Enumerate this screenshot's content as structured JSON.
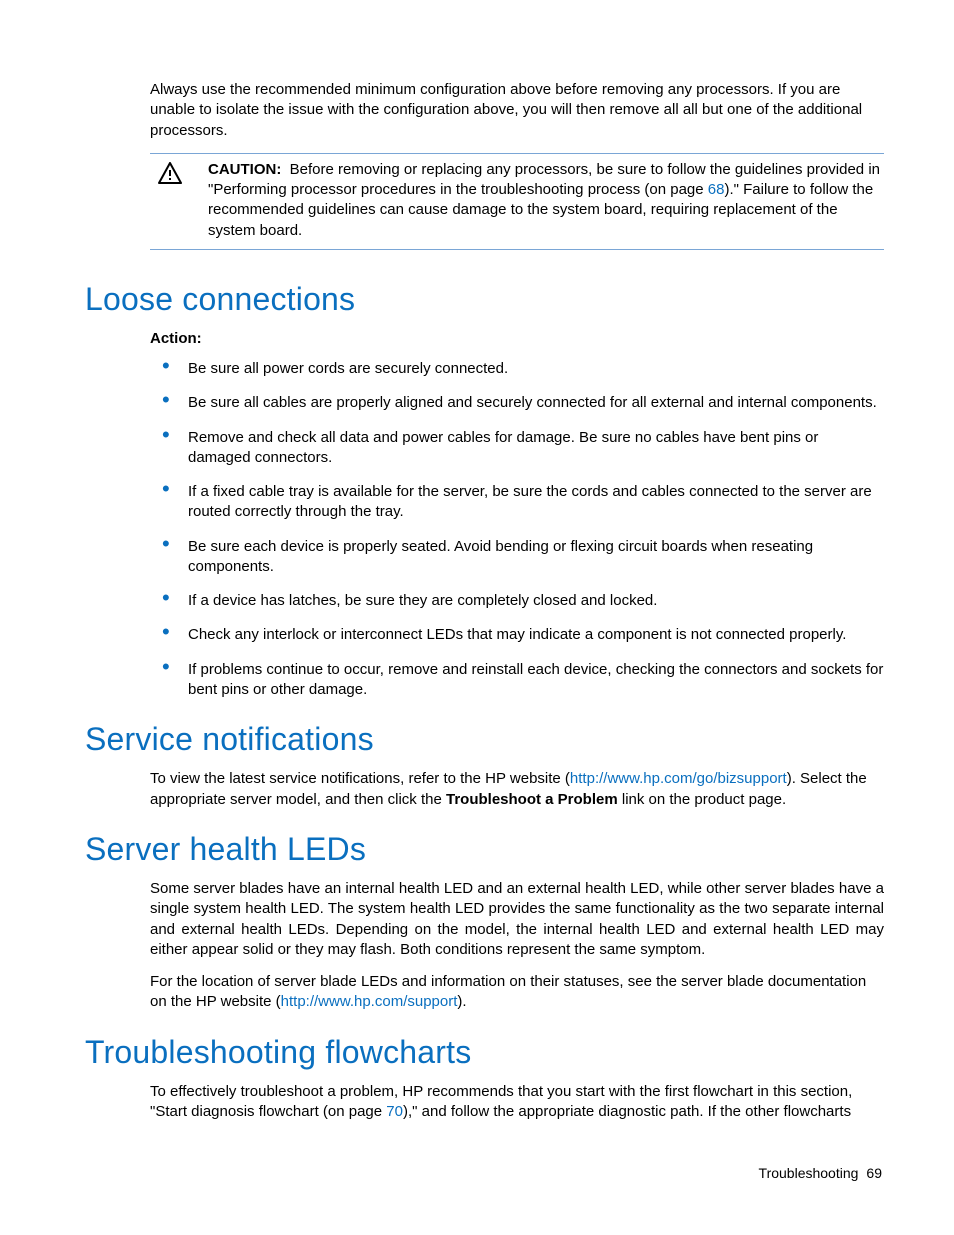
{
  "intro": "Always use the recommended minimum configuration above before removing any processors. If you are unable to isolate the issue with the configuration above, you will then remove all all but one of the additional processors.",
  "caution": {
    "label": "CAUTION:",
    "pre": "Before removing or replacing any processors, be sure to follow the guidelines provided in \"Performing processor procedures in the troubleshooting process (on page ",
    "pagelink": "68",
    "post": ").\" Failure to follow the recommended guidelines can cause damage to the system board, requiring replacement of the system board."
  },
  "section1": {
    "title": "Loose connections",
    "action_label": "Action",
    "items": [
      "Be sure all power cords are securely connected.",
      "Be sure all cables are properly aligned and securely connected for all external and internal components.",
      "Remove and check all data and power cables for damage. Be sure no cables have bent pins or damaged connectors.",
      "If a fixed cable tray is available for the server, be sure the cords and cables connected to the server are routed correctly through the tray.",
      "Be sure each device is properly seated. Avoid bending or flexing circuit boards when reseating components.",
      "If a device has latches, be sure they are completely closed and locked.",
      "Check any interlock or interconnect LEDs that may indicate a component is not connected properly.",
      "If problems continue to occur, remove and reinstall each device, checking the connectors and sockets for bent pins or other damage."
    ]
  },
  "section2": {
    "title": "Service notifications",
    "pre": "To view the latest service notifications, refer to the HP website (",
    "link": "http://www.hp.com/go/bizsupport",
    "mid": "). Select the appropriate server model, and then click the ",
    "bold": "Troubleshoot a Problem",
    "post": " link on the product page."
  },
  "section3": {
    "title": "Server health LEDs",
    "p1": "Some server blades have an internal health LED and an external health LED, while other server blades have a single system health LED. The system health LED provides the same functionality as the two separate internal and external health LEDs. Depending on the model, the internal health LED and external health LED may either appear solid or they may flash. Both conditions represent the same symptom.",
    "p2_pre": "For the location of server blade LEDs and information on their statuses, see the server blade documentation on the HP website (",
    "p2_link": "http://www.hp.com/support",
    "p2_post": ")."
  },
  "section4": {
    "title": "Troubleshooting flowcharts",
    "p_pre": "To effectively troubleshoot a problem, HP recommends that you start with the first flowchart in this section, \"Start diagnosis flowchart (on page ",
    "p_link": "70",
    "p_post": "),\" and follow the appropriate diagnostic path. If the other flowcharts"
  },
  "footer": {
    "label": "Troubleshooting",
    "page": "69"
  }
}
